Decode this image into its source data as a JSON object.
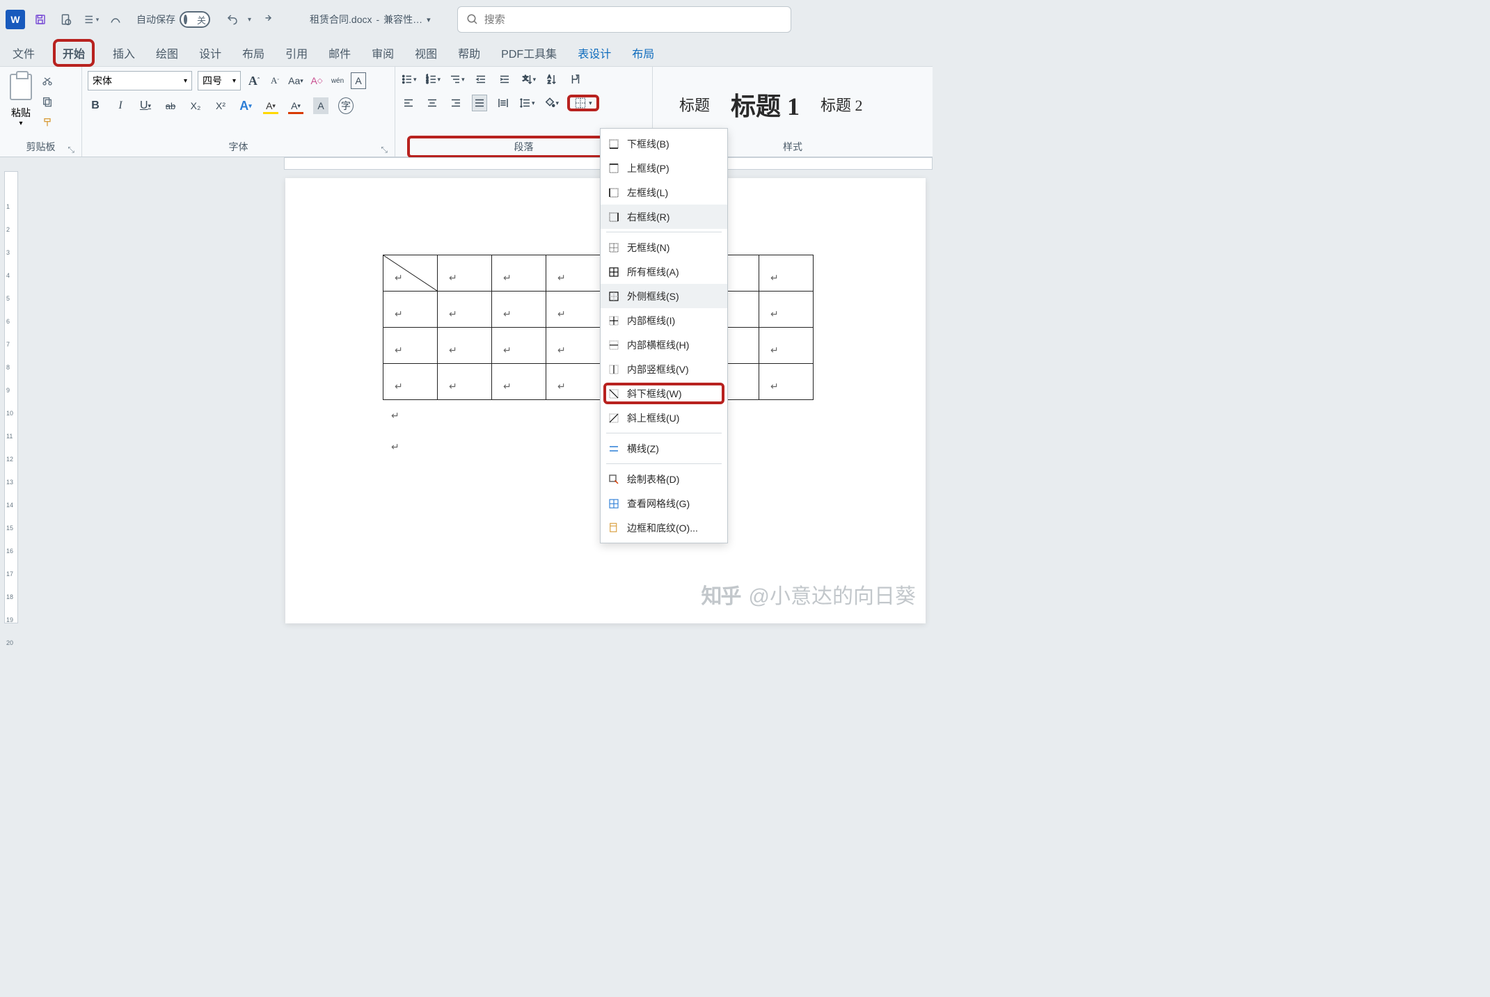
{
  "titlebar": {
    "app": "W",
    "autosave_label": "自动保存",
    "autosave_state": "关",
    "doc_name": "租赁合同.docx",
    "compat": "兼容性…",
    "search_placeholder": "搜索"
  },
  "tabs": {
    "file": "文件",
    "home": "开始",
    "insert": "插入",
    "draw": "绘图",
    "design": "设计",
    "layout": "布局",
    "references": "引用",
    "mailings": "邮件",
    "review": "审阅",
    "view": "视图",
    "help": "帮助",
    "pdf": "PDF工具集",
    "table_design": "表设计",
    "table_layout": "布局"
  },
  "ribbon": {
    "clipboard": {
      "paste": "粘贴",
      "group": "剪贴板"
    },
    "font": {
      "name": "宋体",
      "size": "四号",
      "Aa": "Aa",
      "wen": "wén",
      "B": "B",
      "I": "I",
      "U": "U",
      "ab": "ab",
      "x2": "X₂",
      "x2sup": "X²",
      "A_effect": "A",
      "A_highlight": "A",
      "A_color": "A",
      "A_shade": "A",
      "group": "字体"
    },
    "paragraph": {
      "group": "段落"
    },
    "styles": {
      "normal": "标题",
      "h1": "标题 1",
      "h2": "标题 2",
      "group": "样式"
    }
  },
  "dropdown": {
    "bottom": "下框线(B)",
    "top": "上框线(P)",
    "left": "左框线(L)",
    "right": "右框线(R)",
    "none": "无框线(N)",
    "all": "所有框线(A)",
    "outside": "外侧框线(S)",
    "inside": "内部框线(I)",
    "inside_h": "内部横框线(H)",
    "inside_v": "内部竖框线(V)",
    "diag_down": "斜下框线(W)",
    "diag_up": "斜上框线(U)",
    "hline": "横线(Z)",
    "draw": "绘制表格(D)",
    "grid": "查看网格线(G)",
    "borders_shading": "边框和底纹(O)..."
  },
  "watermark": {
    "logo": "知乎",
    "text": "@小意达的向日葵"
  }
}
